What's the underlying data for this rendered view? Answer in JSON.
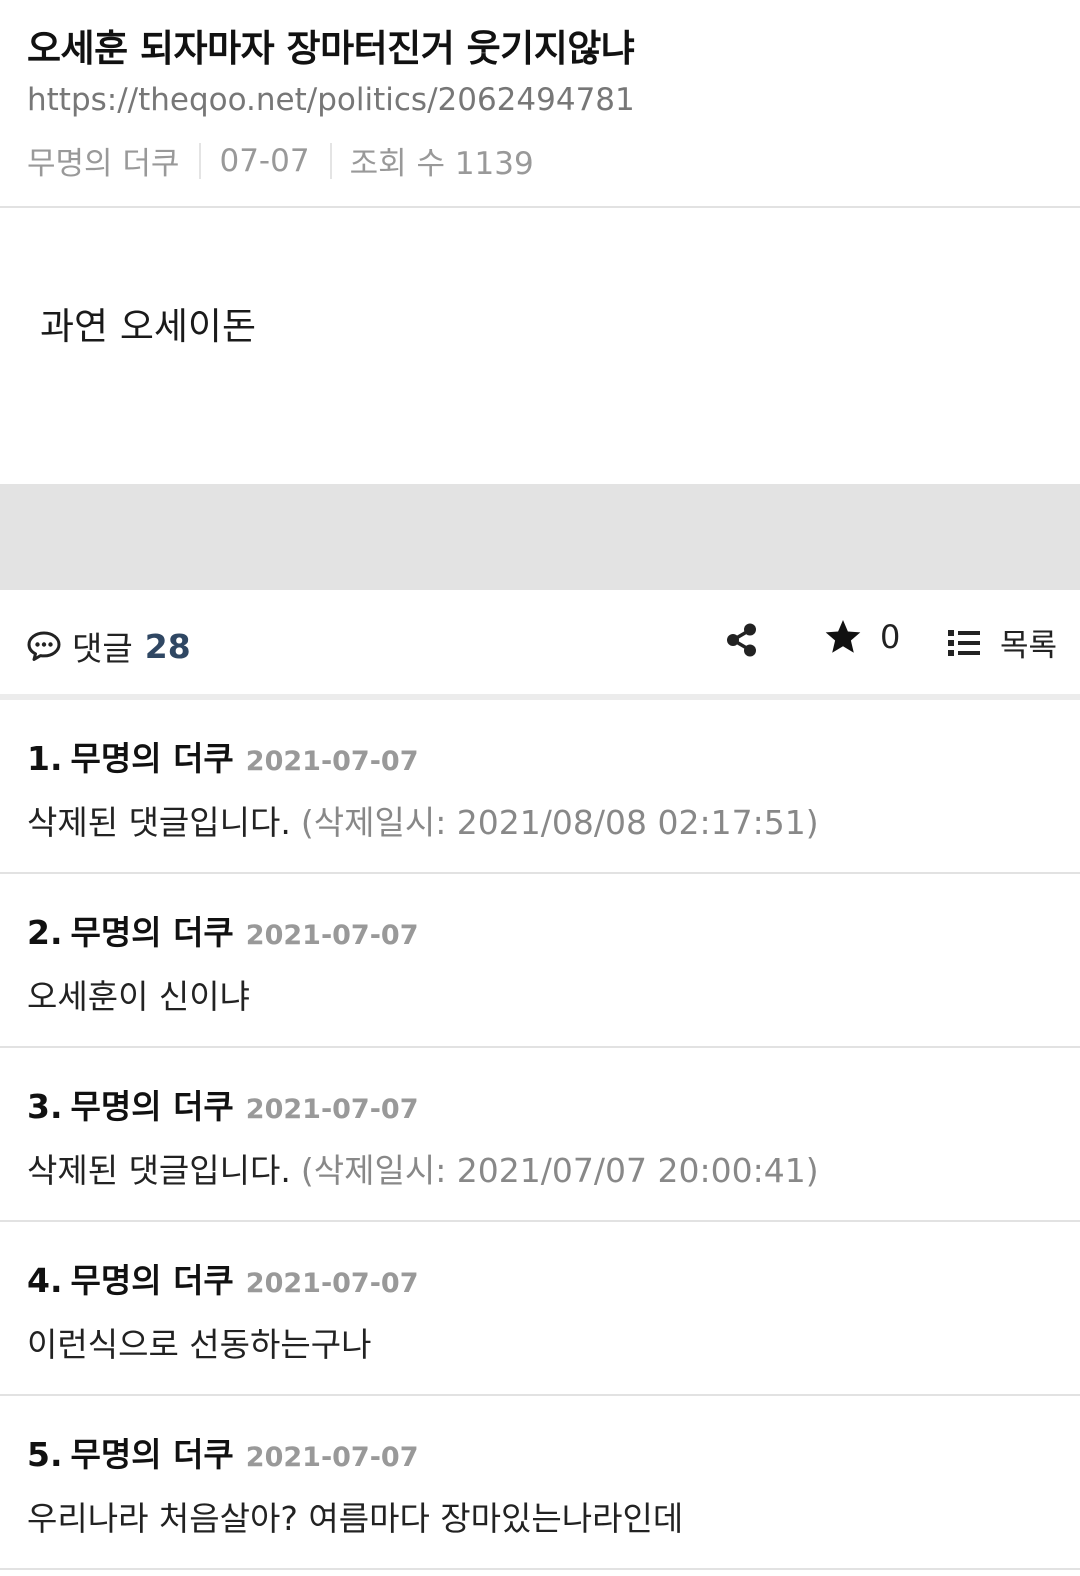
{
  "post": {
    "title": "오세훈 되자마자 장마터진거 웃기지않냐",
    "url": "https://theqoo.net/politics/2062494781",
    "author": "무명의 더쿠",
    "date": "07-07",
    "views": "조회 수 1139",
    "body": "과연 오세이돈"
  },
  "toolbar": {
    "comment_label": "댓글",
    "comment_count": "28",
    "comment_icon": "speech-bubble-icon",
    "share_icon": "share-icon",
    "star_icon": "star-icon",
    "star_count": "0",
    "list_icon": "list-icon",
    "list_label": "목록",
    "accent_color": "#2f4763"
  },
  "comments": [
    {
      "num": "1.",
      "author": "무명의 더쿠",
      "date": "2021-07-07",
      "text": "삭제된 댓글입니다.",
      "deleted_at": "(삭제일시: 2021/08/08 02:17:51)"
    },
    {
      "num": "2.",
      "author": "무명의 더쿠",
      "date": "2021-07-07",
      "text": "오세훈이 신이냐",
      "deleted_at": ""
    },
    {
      "num": "3.",
      "author": "무명의 더쿠",
      "date": "2021-07-07",
      "text": "삭제된 댓글입니다.",
      "deleted_at": "(삭제일시: 2021/07/07 20:00:41)"
    },
    {
      "num": "4.",
      "author": "무명의 더쿠",
      "date": "2021-07-07",
      "text": "이런식으로 선동하는구나",
      "deleted_at": ""
    },
    {
      "num": "5.",
      "author": "무명의 더쿠",
      "date": "2021-07-07",
      "text": "우리나라 처음살아? 여름마다 장마있는나라인데",
      "deleted_at": ""
    }
  ]
}
